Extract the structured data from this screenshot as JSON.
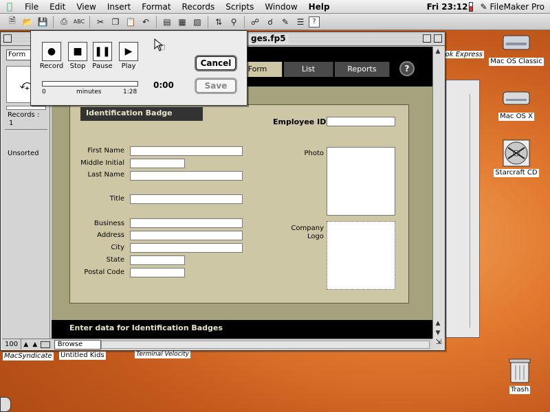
{
  "menubar": {
    "items": [
      "File",
      "Edit",
      "View",
      "Insert",
      "Format",
      "Records",
      "Scripts",
      "Window",
      "Help"
    ],
    "clock": "Fri 23:12",
    "app_name": "FileMaker Pro"
  },
  "desktop": {
    "icons": [
      {
        "label": "Mac OS Classic",
        "icon": "hard-disk-icon"
      },
      {
        "label": "Mac OS X",
        "icon": "hard-disk-icon"
      },
      {
        "label": "Starcraft CD",
        "icon": "cd-icon"
      },
      {
        "label": "Trash",
        "icon": "trash-icon"
      }
    ],
    "partial_labels": {
      "top_right": "ok Express",
      "bottom_left": "MacSyndicate",
      "bottom_mid1": "Untitled Kids",
      "bottom_mid2": "Terminal Velocity"
    }
  },
  "window": {
    "title": "ges.fp5",
    "layout_popup": "Form",
    "records_label": "Records :",
    "records_count": "1",
    "sort_status": "Unsorted",
    "zoom": "100",
    "mode": "Browse"
  },
  "layout": {
    "tabs": [
      "Form",
      "List",
      "Reports"
    ],
    "active_tab": "Form",
    "help": "?",
    "panel_title": "Identification Badge",
    "labels": {
      "employee_id": "Employee ID",
      "first_name": "First Name",
      "middle_initial": "Middle Initial",
      "last_name": "Last Name",
      "title": "Title",
      "business": "Business",
      "address": "Address",
      "city": "City",
      "state": "State",
      "postal_code": "Postal Code",
      "photo": "Photo",
      "company_logo_1": "Company",
      "company_logo_2": "Logo"
    },
    "footer": "Enter data for Identification Badges"
  },
  "audio_dialog": {
    "buttons": [
      "Record",
      "Stop",
      "Pause",
      "Play"
    ],
    "cancel": "Cancel",
    "save": "Save",
    "time": "0:00",
    "range_start": "0",
    "range_unit": "minutes",
    "range_end": "1:28",
    "progress": 0
  }
}
